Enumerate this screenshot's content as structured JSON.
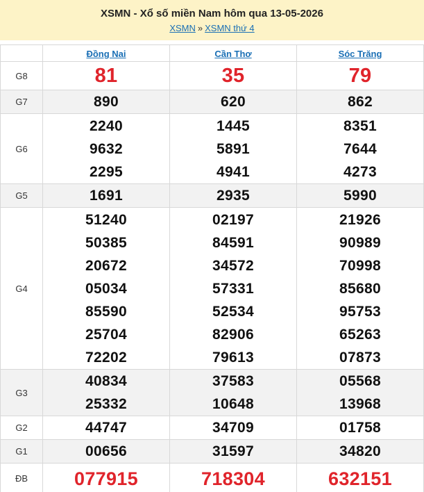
{
  "header": {
    "title": "XSMN - Xổ số miền Nam hôm qua 13-05-2026",
    "breadcrumb": {
      "link1": "XSMN",
      "separator": "»",
      "link2": "XSMN thứ 4"
    }
  },
  "colors": {
    "header_bg": "#fdf3c7",
    "link": "#1a6fb5",
    "highlight_red": "#e0242b",
    "alt_row": "#f2f2f2"
  },
  "provinces": [
    "Đồng Nai",
    "Cần Thơ",
    "Sóc Trăng"
  ],
  "prizes": [
    {
      "label": "G8",
      "style": "big-red",
      "values": [
        [
          "81"
        ],
        [
          "35"
        ],
        [
          "79"
        ]
      ]
    },
    {
      "label": "G7",
      "style": "normal",
      "values": [
        [
          "890"
        ],
        [
          "620"
        ],
        [
          "862"
        ]
      ]
    },
    {
      "label": "G6",
      "style": "normal",
      "values": [
        [
          "2240",
          "9632",
          "2295"
        ],
        [
          "1445",
          "5891",
          "4941"
        ],
        [
          "8351",
          "7644",
          "4273"
        ]
      ]
    },
    {
      "label": "G5",
      "style": "normal",
      "values": [
        [
          "1691"
        ],
        [
          "2935"
        ],
        [
          "5990"
        ]
      ]
    },
    {
      "label": "G4",
      "style": "normal",
      "values": [
        [
          "51240",
          "50385",
          "20672",
          "05034",
          "85590",
          "25704",
          "72202"
        ],
        [
          "02197",
          "84591",
          "34572",
          "57331",
          "52534",
          "82906",
          "79613"
        ],
        [
          "21926",
          "90989",
          "70998",
          "85680",
          "95753",
          "65263",
          "07873"
        ]
      ]
    },
    {
      "label": "G3",
      "style": "normal",
      "values": [
        [
          "40834",
          "25332"
        ],
        [
          "37583",
          "10648"
        ],
        [
          "05568",
          "13968"
        ]
      ]
    },
    {
      "label": "G2",
      "style": "normal",
      "values": [
        [
          "44747"
        ],
        [
          "34709"
        ],
        [
          "01758"
        ]
      ]
    },
    {
      "label": "G1",
      "style": "normal",
      "values": [
        [
          "00656"
        ],
        [
          "31597"
        ],
        [
          "34820"
        ]
      ]
    },
    {
      "label": "ĐB",
      "style": "special-red",
      "values": [
        [
          "077915"
        ],
        [
          "718304"
        ],
        [
          "632151"
        ]
      ]
    }
  ]
}
